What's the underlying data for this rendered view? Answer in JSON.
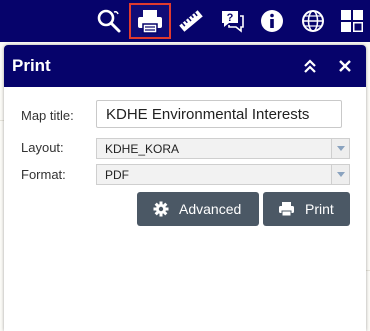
{
  "toolbar": {
    "tools": [
      {
        "icon": "search-icon"
      },
      {
        "icon": "printer-icon",
        "active": true
      },
      {
        "icon": "ruler-icon"
      },
      {
        "icon": "chat-help-icon"
      },
      {
        "icon": "info-icon"
      },
      {
        "icon": "globe-icon"
      },
      {
        "icon": "dashboard-icon"
      }
    ],
    "active_border_color": "#e03a2e",
    "background_color": "#06036b"
  },
  "panel": {
    "title": "Print",
    "collapse_icon": "chevron-double-up-icon",
    "close_icon": "close-icon"
  },
  "form": {
    "map_title_label": "Map title:",
    "map_title_value": "KDHE Environmental Interests",
    "layout_label": "Layout:",
    "layout_value": "KDHE_KORA",
    "format_label": "Format:",
    "format_value": "PDF"
  },
  "buttons": {
    "advanced_label": "Advanced",
    "advanced_icon": "gear-icon",
    "print_label": "Print",
    "print_icon": "printer-icon",
    "color": "#4b5865"
  }
}
